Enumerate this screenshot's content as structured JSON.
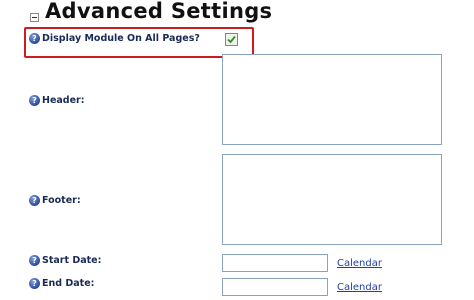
{
  "section": {
    "title": "Advanced Settings"
  },
  "fields": {
    "display_all": {
      "label": "Display Module On All Pages?",
      "checked": true
    },
    "header": {
      "label": "Header:",
      "value": ""
    },
    "footer": {
      "label": "Footer:",
      "value": ""
    },
    "start_date": {
      "label": "Start Date:",
      "value": "",
      "calendar_link": "Calendar"
    },
    "end_date": {
      "label": "End Date:",
      "value": "",
      "calendar_link": "Calendar"
    }
  },
  "icons": {
    "help": "help-icon",
    "collapse": "collapse-toggle-icon",
    "check": "checkmark-icon"
  },
  "colors": {
    "highlight": "#cc1c1c",
    "label": "#1a2a55",
    "link": "#1f3fa8",
    "check": "#3a8a2a"
  }
}
